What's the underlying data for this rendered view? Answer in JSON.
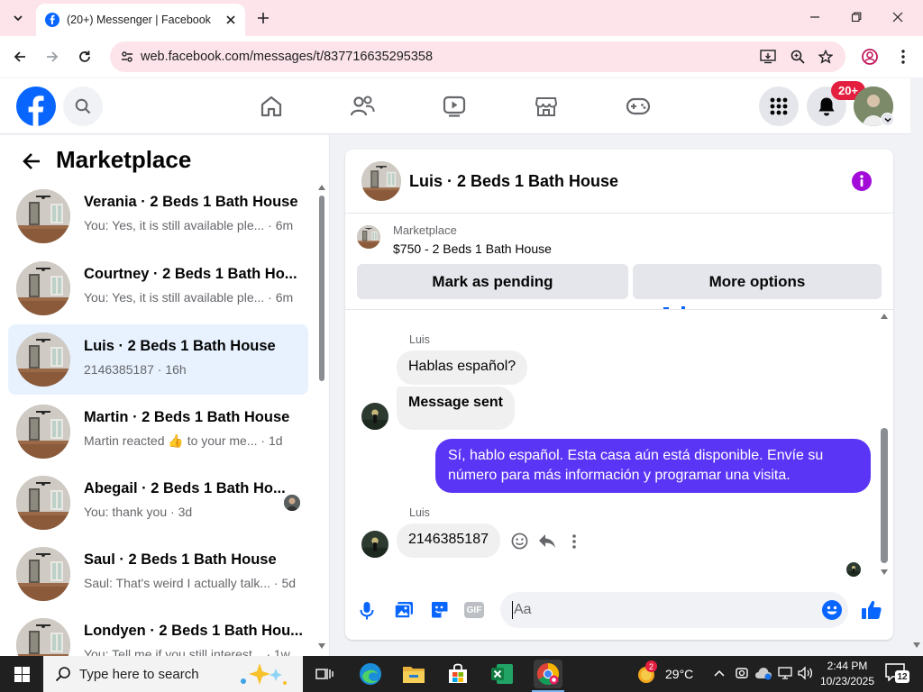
{
  "browser": {
    "tab_title": "(20+) Messenger | Facebook",
    "url": "web.facebook.com/messages/t/837716635295358"
  },
  "fbnav": {
    "notification_badge": "20+"
  },
  "left_pane": {
    "title": "Marketplace",
    "conversations": [
      {
        "title": "Verania · 2 Beds 1 Bath House",
        "snippet": "You: Yes, it is still available ple...",
        "time": "· 6m"
      },
      {
        "title": "Courtney · 2 Beds 1 Bath Ho...",
        "snippet": "You: Yes, it is still available ple...",
        "time": "· 6m"
      },
      {
        "title": "Luis · 2 Beds 1 Bath House",
        "snippet": "2146385187",
        "time": "· 16h"
      },
      {
        "title": "Martin · 2 Beds 1 Bath House",
        "snippet_a": "Martin reacted",
        "snippet_b": "to your me...",
        "time": "· 1d"
      },
      {
        "title": "Abegail · 2 Beds 1 Bath Ho...",
        "snippet": "You: thank you",
        "time": "· 3d"
      },
      {
        "title": "Saul · 2 Beds 1 Bath House",
        "snippet": "Saul: That's weird I actually talk...",
        "time": "· 5d"
      },
      {
        "title": "Londyen · 2 Beds 1 Bath Hou...",
        "snippet": "You: Tell me if you still interest...",
        "time": "· 1w"
      }
    ]
  },
  "chat": {
    "header_title": "Luis · 2 Beds 1 Bath House",
    "listing_source": "Marketplace",
    "listing_text": "$750 - 2 Beds 1 Bath House",
    "mark_pending_label": "Mark as pending",
    "more_options_label": "More options",
    "sender_name_1": "Luis",
    "msg_1": "Hablas español?",
    "msg_2": "Message sent",
    "msg_own": "Sí, hablo español. Esta casa aún está disponible. Envíe su número para más información y programar una visita.",
    "sender_name_2": "Luis",
    "msg_3": "2146385187",
    "composer_placeholder": "Aa"
  },
  "taskbar": {
    "search_placeholder": "Type here to search",
    "weather_temp": "29°C",
    "weather_badge": "2",
    "time": "2:44 PM",
    "date": "10/23/2025",
    "notif_count": "12"
  },
  "colors": {
    "accent": "#0866ff",
    "own_bubble": "#5b35f5",
    "info_icon": "#a20bd8",
    "badge_red": "#e41e3f"
  }
}
